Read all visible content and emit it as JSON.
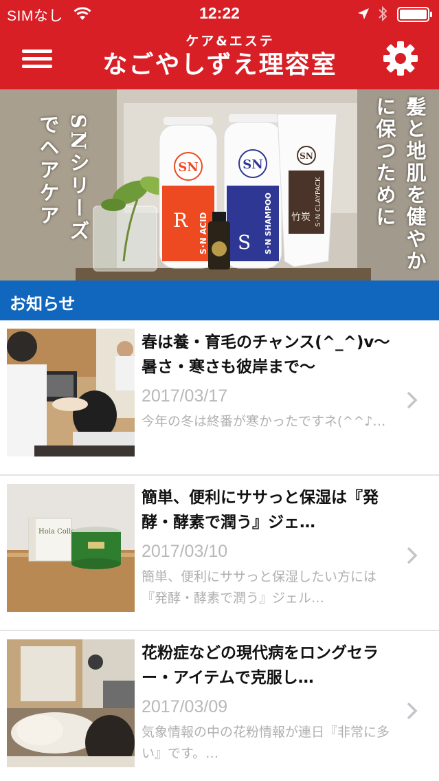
{
  "status_bar": {
    "carrier": "SIMなし",
    "time": "12:22",
    "icons": [
      "wifi-icon",
      "location-icon",
      "bluetooth-icon",
      "battery-icon"
    ]
  },
  "header": {
    "subtitle": "ケア&エステ",
    "title": "なごやしずえ理容室",
    "menu_icon": "hamburger-menu-icon",
    "settings_icon": "gear-icon",
    "background_color": "#d81f26"
  },
  "hero": {
    "left_text": "SNシリーズでヘアケア",
    "right_text": "髪と地肌を健やかに保つために",
    "product_labels": {
      "acid_letter": "R",
      "acid_name": "S･N ACID",
      "shampoo_letter": "S",
      "shampoo_name": "S･N SHAMPOO",
      "pack_name": "S･N CLAYPACK",
      "pack_label": "竹炭",
      "brand_mark": "SN"
    }
  },
  "section": {
    "title": "お知らせ",
    "background_color": "#1167bd"
  },
  "news": [
    {
      "title": "春は養・育毛のチャンス(^_^)v〜暑さ・寒さも彼岸まで〜",
      "date": "2017/03/17",
      "excerpt": "今年の冬は終番が寒かったですネ(^^♪…"
    },
    {
      "title": "簡単、便利にササっと保湿は『発酵・酵素で潤う』ジェ…",
      "date": "2017/03/10",
      "excerpt": "簡単、便利にササっと保湿したい方には『発酵・酵素で潤う』ジェル…",
      "thumb_box_text": "Hola Collection"
    },
    {
      "title": "花粉症などの現代病をロングセラー・アイテムで克服し…",
      "date": "2017/03/09",
      "excerpt": "気象情報の中の花粉情報が連日『非常に多い』です。…"
    }
  ]
}
